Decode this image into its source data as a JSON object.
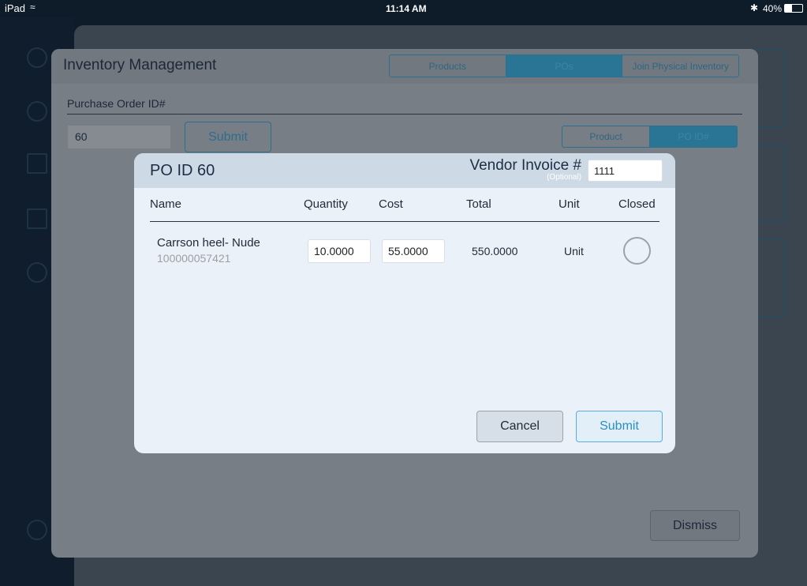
{
  "status_bar": {
    "device": "iPad",
    "time": "11:14 AM",
    "battery": "40%",
    "battery_level": 0.4
  },
  "inventory": {
    "title": "Inventory Management",
    "tabs": [
      {
        "label": "Products",
        "selected": false
      },
      {
        "label": "POs",
        "selected": true
      },
      {
        "label": "Join Physical Inventory",
        "selected": false
      }
    ],
    "po_label": "Purchase Order ID#",
    "po_value": "60",
    "submit_label": "Submit",
    "search_mode": [
      {
        "label": "Product",
        "selected": false
      },
      {
        "label": "PO ID#",
        "selected": true
      }
    ],
    "dismiss_label": "Dismiss"
  },
  "dialog": {
    "title": "PO ID 60",
    "vendor_label": "Vendor Invoice #",
    "vendor_optional": "(Optional)",
    "vendor_value": "1111",
    "columns": [
      "Name",
      "Quantity",
      "Cost",
      "Total",
      "Unit",
      "Closed"
    ],
    "rows": [
      {
        "name": "Carrson heel- Nude",
        "sku": "100000057421",
        "quantity": "10.0000",
        "cost": "55.0000",
        "total": "550.0000",
        "unit": "Unit",
        "closed": false
      }
    ],
    "cancel_label": "Cancel",
    "submit_label": "Submit"
  },
  "colors": {
    "accent": "#2a8fc0",
    "selected_segment": "#2a7596"
  }
}
